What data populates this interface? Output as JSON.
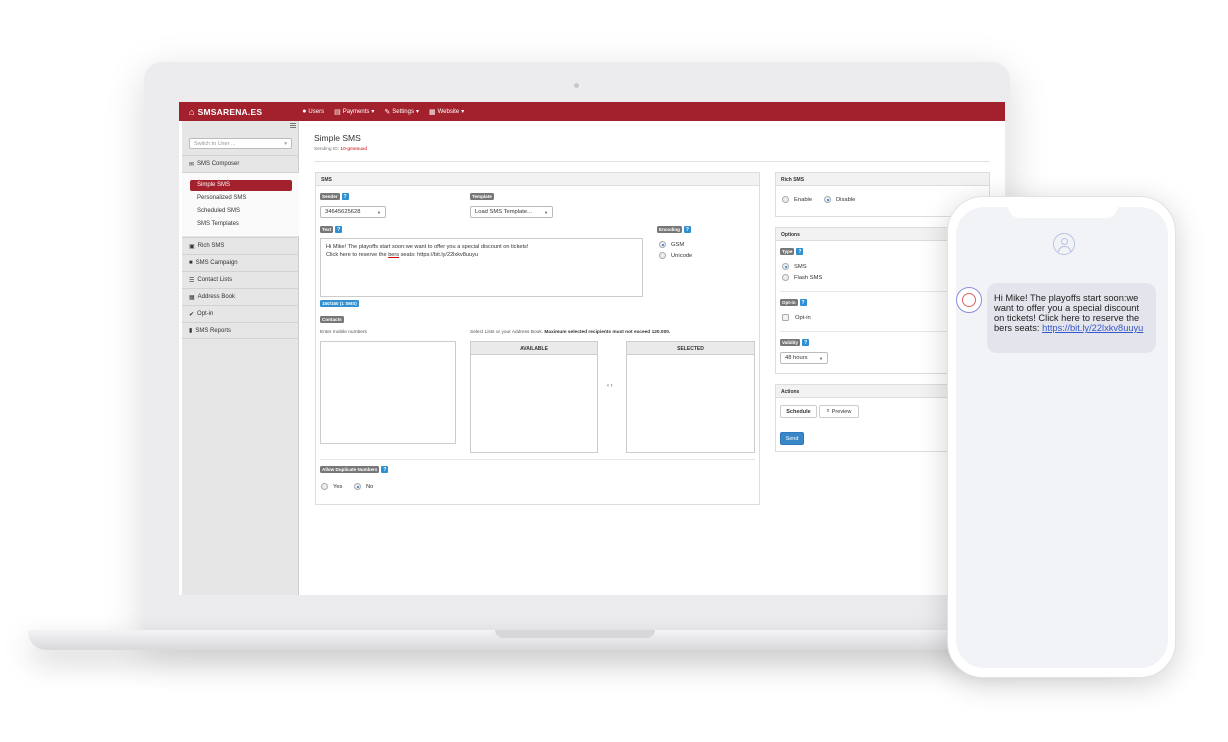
{
  "app": {
    "brand": "SMSARENA.ES"
  },
  "nav": [
    {
      "label": "Users",
      "icon": "user-icon",
      "dropdown": false
    },
    {
      "label": "Payments",
      "icon": "bank-icon",
      "dropdown": true
    },
    {
      "label": "Settings",
      "icon": "wrench-icon",
      "dropdown": true
    },
    {
      "label": "Website",
      "icon": "grid-icon",
      "dropdown": true
    }
  ],
  "sidebar": {
    "switch_user_placeholder": "Switch to User ...",
    "sections": [
      {
        "label": "SMS Composer",
        "icon": "envelope-icon"
      },
      {
        "label": "Rich SMS",
        "icon": "image-icon"
      },
      {
        "label": "SMS Campaign",
        "icon": "briefcase-icon"
      },
      {
        "label": "Contact Lists",
        "icon": "list-icon"
      },
      {
        "label": "Address Book",
        "icon": "grid-icon"
      },
      {
        "label": "Opt-in",
        "icon": "check-circle-icon"
      },
      {
        "label": "SMS Reports",
        "icon": "file-icon"
      }
    ],
    "composer_items": [
      "Simple SMS",
      "Personalized SMS",
      "Scheduled SMS",
      "SMS Templates"
    ],
    "active_item": "Simple SMS"
  },
  "page": {
    "title": "Simple SMS",
    "sending_id_label": "Sending ID:",
    "sending_id_value": "10-gmenuxd"
  },
  "sms_panel": {
    "heading": "SMS",
    "sender_label": "Sender",
    "sender_value": "34645625628",
    "template_label": "Template",
    "template_value": "Load SMS Template...",
    "text_label": "Text",
    "text_line1": "Hi Mike! The playoffs start soon:we want to offer you a special discount on tickets!",
    "text_line2_pre": "Click here to reserve the ",
    "text_line2_misspelled": "bers",
    "text_line2_post": " seats: https://bit.ly/22lxkv8uuyu",
    "encoding_label": "Encoding",
    "encoding_options": [
      "GSM",
      "Unicode"
    ],
    "encoding_selected": "GSM",
    "char_count": "150/160 (1 SMS)",
    "contacts_label": "Contacts",
    "enter_numbers": "Enter mobile numbers",
    "select_lists_text": "Select Lists or your Address Book.",
    "select_lists_bold": "Maximum selected recipients must not exceed 120.000.",
    "available_header": "AVAILABLE",
    "selected_header": "SELECTED",
    "move_arrows": "‹ ›",
    "allow_dup_label": "Allow Duplicate Numbers",
    "allow_dup_options": [
      "Yes",
      "No"
    ],
    "allow_dup_selected": "No"
  },
  "rich_sms": {
    "heading": "Rich SMS",
    "options": [
      "Enable",
      "Disable"
    ],
    "selected": "Disable"
  },
  "options_panel": {
    "heading": "Options",
    "type_label": "Type",
    "type_options": [
      "SMS",
      "Flash SMS"
    ],
    "type_selected": "SMS",
    "optin_label": "Opt-in",
    "optin_checkbox": "Opt-in",
    "validity_label": "Validity",
    "validity_value": "48 hours"
  },
  "actions_panel": {
    "heading": "Actions",
    "schedule": "Schedule",
    "preview": "Preview",
    "send": "Send"
  },
  "phone": {
    "message_pre": "Hi Mike! The playoffs start soon:we want to offer you a special discount on tickets! Click here to reserve the bers seats: ",
    "message_link": "https://bit.ly/22lxkv8uuyu"
  },
  "colors": {
    "brand": "#a3212c",
    "accent": "#2f8fd0",
    "primary_button": "#3a87c8"
  }
}
